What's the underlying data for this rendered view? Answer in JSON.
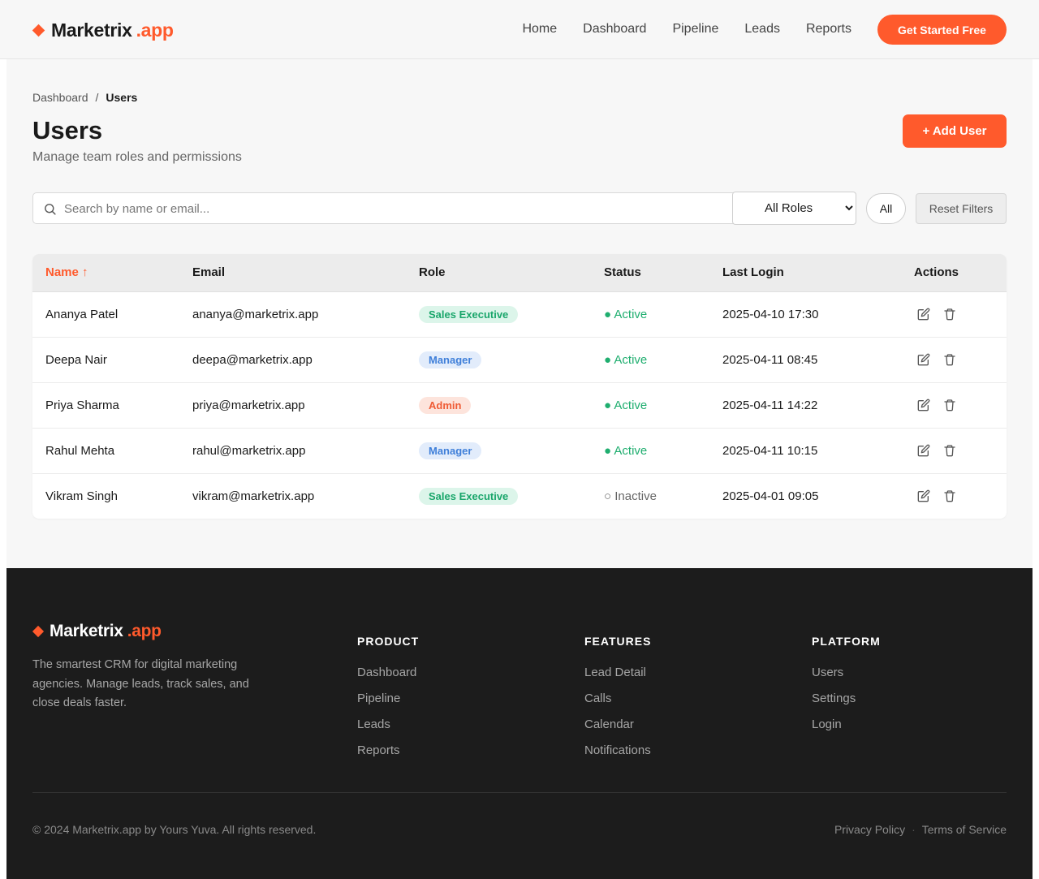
{
  "brand": {
    "name": "Marketrix",
    "suffix": ".app"
  },
  "nav": {
    "items": [
      "Home",
      "Dashboard",
      "Pipeline",
      "Leads",
      "Reports"
    ],
    "cta": "Get Started Free"
  },
  "breadcrumb": {
    "parent": "Dashboard",
    "separator": "/",
    "current": "Users"
  },
  "page": {
    "title": "Users",
    "subtitle": "Manage team roles and permissions",
    "add_button": "+ Add User"
  },
  "filters": {
    "search_placeholder": "Search by name or email...",
    "role_select_value": "All Roles",
    "status_button": "All",
    "reset_button": "Reset Filters"
  },
  "table": {
    "columns": [
      "Name ↑",
      "Email",
      "Role",
      "Status",
      "Last Login",
      "Actions"
    ],
    "rows": [
      {
        "name": "Ananya Patel",
        "email": "ananya@marketrix.app",
        "role": "Sales Executive",
        "role_kind": "sales",
        "status": "● Active",
        "status_kind": "active",
        "last_login": "2025-04-10 17:30"
      },
      {
        "name": "Deepa Nair",
        "email": "deepa@marketrix.app",
        "role": "Manager",
        "role_kind": "manager",
        "status": "● Active",
        "status_kind": "active",
        "last_login": "2025-04-11 08:45"
      },
      {
        "name": "Priya Sharma",
        "email": "priya@marketrix.app",
        "role": "Admin",
        "role_kind": "admin",
        "status": "● Active",
        "status_kind": "active",
        "last_login": "2025-04-11 14:22"
      },
      {
        "name": "Rahul Mehta",
        "email": "rahul@marketrix.app",
        "role": "Manager",
        "role_kind": "manager",
        "status": "● Active",
        "status_kind": "active",
        "last_login": "2025-04-11 10:15"
      },
      {
        "name": "Vikram Singh",
        "email": "vikram@marketrix.app",
        "role": "Sales Executive",
        "role_kind": "sales",
        "status": "○ Inactive",
        "status_kind": "inactive",
        "last_login": "2025-04-01 09:05"
      }
    ],
    "action_icons": [
      "edit-icon",
      "trash-icon"
    ]
  },
  "colors": {
    "accent": "#ff5a2c",
    "role_sales_bg": "#dcf5ea",
    "role_sales_fg": "#1aa66b",
    "role_manager_bg": "#e2ecfb",
    "role_manager_fg": "#3f7fd9",
    "role_admin_bg": "#fde4dc",
    "role_admin_fg": "#ef5b35",
    "status_active": "#1fae6f",
    "status_inactive": "#666666"
  },
  "footer": {
    "description": "The smartest CRM for digital marketing agencies. Manage leads, track sales, and close deals faster.",
    "columns": [
      {
        "title": "PRODUCT",
        "links": [
          "Dashboard",
          "Pipeline",
          "Leads",
          "Reports"
        ]
      },
      {
        "title": "FEATURES",
        "links": [
          "Lead Detail",
          "Calls",
          "Calendar",
          "Notifications"
        ]
      },
      {
        "title": "PLATFORM",
        "links": [
          "Users",
          "Settings",
          "Login"
        ]
      }
    ],
    "copyright": "© 2024 Marketrix.app by Yours Yuva. All rights reserved.",
    "legal": [
      "Privacy Policy",
      "·",
      "Terms of Service"
    ]
  }
}
